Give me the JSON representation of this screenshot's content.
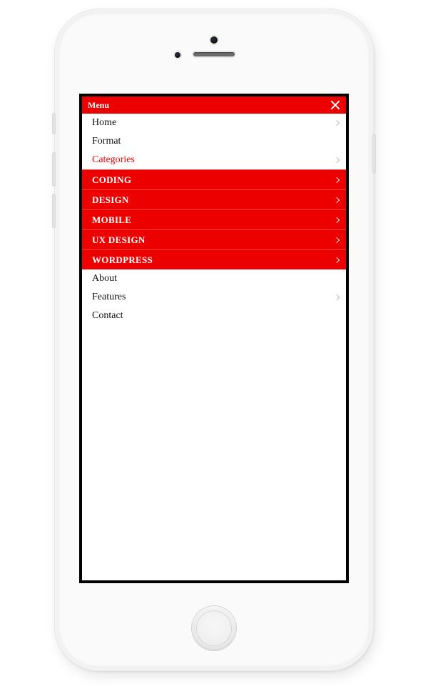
{
  "colors": {
    "accent": "#ed0000"
  },
  "header": {
    "title": "Menu"
  },
  "menu": [
    {
      "id": "home",
      "label": "Home",
      "hasChevron": true,
      "style": "normal"
    },
    {
      "id": "format",
      "label": "Format",
      "hasChevron": false,
      "style": "normal"
    },
    {
      "id": "categories",
      "label": "Categories",
      "hasChevron": true,
      "style": "active",
      "children": [
        {
          "id": "coding",
          "label": "CODING",
          "hasChevron": true
        },
        {
          "id": "design",
          "label": "DESIGN",
          "hasChevron": true
        },
        {
          "id": "mobile",
          "label": "MOBILE",
          "hasChevron": true
        },
        {
          "id": "ux-design",
          "label": "UX DESIGN",
          "hasChevron": true
        },
        {
          "id": "wordpress",
          "label": "WORDPRESS",
          "hasChevron": true
        }
      ]
    },
    {
      "id": "about",
      "label": "About",
      "hasChevron": false,
      "style": "normal"
    },
    {
      "id": "features",
      "label": "Features",
      "hasChevron": true,
      "style": "normal"
    },
    {
      "id": "contact",
      "label": "Contact",
      "hasChevron": false,
      "style": "normal"
    }
  ]
}
